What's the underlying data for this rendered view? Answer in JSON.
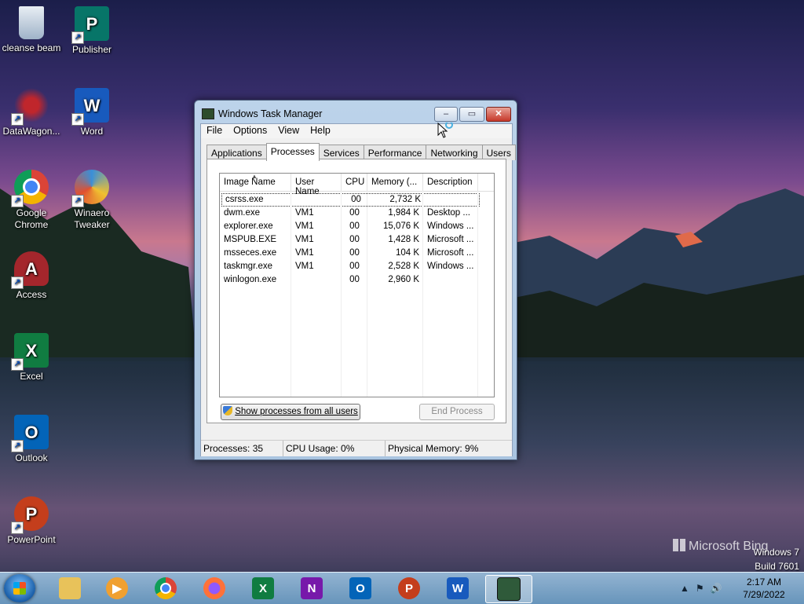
{
  "desktop": {
    "icons": [
      {
        "label": "cleanse beam",
        "icon": "recycle-bin-icon",
        "color": "#9fb3c8"
      },
      {
        "label": "Publisher",
        "icon": "publisher-icon",
        "color": "#077568"
      },
      {
        "label": "DataWagon...",
        "icon": "datawagon-icon",
        "color": "#c0262c"
      },
      {
        "label": "Word",
        "icon": "word-icon",
        "color": "#185abd"
      },
      {
        "label": "Google Chrome",
        "icon": "chrome-icon",
        "color": "#db4437"
      },
      {
        "label": "Winaero Tweaker",
        "icon": "winaero-icon",
        "color": "#3a8fd8"
      },
      {
        "label": "Access",
        "icon": "access-icon",
        "color": "#a4262c"
      },
      {
        "label": "Excel",
        "icon": "excel-icon",
        "color": "#107c41"
      },
      {
        "label": "Outlook",
        "icon": "outlook-icon",
        "color": "#0364b8"
      },
      {
        "label": "PowerPoint",
        "icon": "powerpoint-icon",
        "color": "#c43e1c"
      }
    ],
    "letters": {
      "publisher": "P",
      "word": "W",
      "access": "A",
      "excel": "X",
      "outlook": "O",
      "powerpoint": "P"
    }
  },
  "window": {
    "title": "Windows Task Manager",
    "menu": [
      "File",
      "Options",
      "View",
      "Help"
    ],
    "tabs": [
      "Applications",
      "Processes",
      "Services",
      "Performance",
      "Networking",
      "Users"
    ],
    "active_tab": "Processes",
    "columns": [
      "Image Name",
      "User Name",
      "CPU",
      "Memory (...",
      "Description"
    ],
    "rows": [
      {
        "image": "csrss.exe",
        "user": "",
        "cpu": "00",
        "memory": "2,732 K",
        "desc": ""
      },
      {
        "image": "dwm.exe",
        "user": "VM1",
        "cpu": "00",
        "memory": "1,984 K",
        "desc": "Desktop ..."
      },
      {
        "image": "explorer.exe",
        "user": "VM1",
        "cpu": "00",
        "memory": "15,076 K",
        "desc": "Windows ..."
      },
      {
        "image": "MSPUB.EXE",
        "user": "VM1",
        "cpu": "00",
        "memory": "1,428 K",
        "desc": "Microsoft ..."
      },
      {
        "image": "msseces.exe",
        "user": "VM1",
        "cpu": "00",
        "memory": "104 K",
        "desc": "Microsoft ..."
      },
      {
        "image": "taskmgr.exe",
        "user": "VM1",
        "cpu": "00",
        "memory": "2,528 K",
        "desc": "Windows ..."
      },
      {
        "image": "winlogon.exe",
        "user": "",
        "cpu": "00",
        "memory": "2,960 K",
        "desc": ""
      }
    ],
    "show_all_label": "Show processes from all users",
    "end_process_label": "End Process",
    "status": {
      "processes": "Processes: 35",
      "cpu": "CPU Usage: 0%",
      "memory": "Physical Memory: 9%"
    }
  },
  "watermark": {
    "brand": "Microsoft Bing"
  },
  "os": {
    "name": "Windows 7",
    "build": "Build 7601"
  },
  "taskbar": {
    "items": [
      {
        "name": "explorer",
        "icon": "folder-icon",
        "color": "#e8c25a",
        "letter": ""
      },
      {
        "name": "media-player",
        "icon": "media-player-icon",
        "color": "#f0a030",
        "letter": ""
      },
      {
        "name": "chrome",
        "icon": "chrome-icon",
        "color": "#db4437",
        "letter": ""
      },
      {
        "name": "firefox",
        "icon": "firefox-icon",
        "color": "#ff7139",
        "letter": ""
      },
      {
        "name": "excel",
        "icon": "excel-icon",
        "color": "#107c41",
        "letter": "X"
      },
      {
        "name": "onenote",
        "icon": "onenote-icon",
        "color": "#7719aa",
        "letter": "N"
      },
      {
        "name": "outlook",
        "icon": "outlook-icon",
        "color": "#0364b8",
        "letter": "O"
      },
      {
        "name": "powerpoint",
        "icon": "powerpoint-icon",
        "color": "#c43e1c",
        "letter": "P"
      },
      {
        "name": "word",
        "icon": "word-icon",
        "color": "#185abd",
        "letter": "W"
      },
      {
        "name": "task-manager",
        "icon": "task-manager-icon",
        "color": "#2f5a3a",
        "letter": ""
      }
    ],
    "time": "2:17 AM",
    "date": "7/29/2022"
  }
}
